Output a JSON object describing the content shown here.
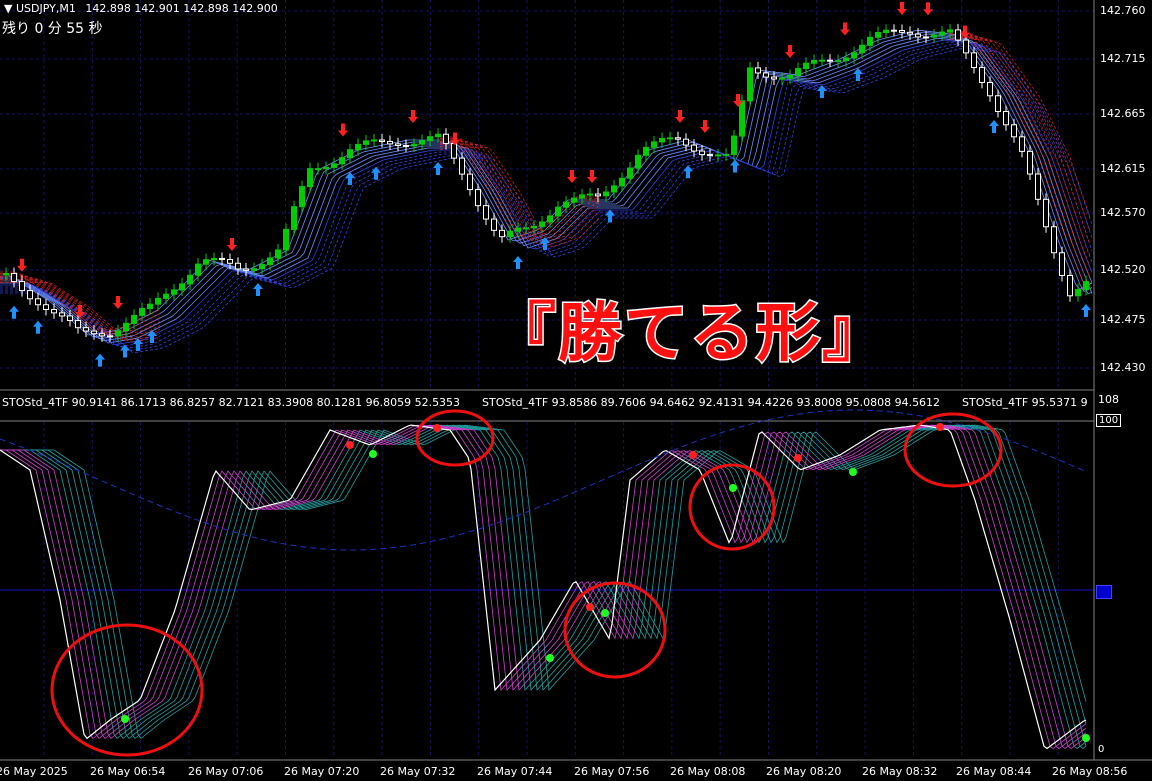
{
  "header": {
    "symbol": "USDJPY,M1",
    "ohlc": "142.898 142.901 142.898 142.900",
    "countdown": "残り 0 分 55 秒"
  },
  "headline": "『勝てる形』",
  "price_axis": {
    "labels": [
      "142.760",
      "142.715",
      "142.665",
      "142.615",
      "142.570",
      "142.520",
      "142.475",
      "142.430"
    ]
  },
  "indicator": {
    "label1": "STOStd_4TF 90.9141 86.1713 86.8257 82.7121 83.3908 80.1281 96.8059 52.5353",
    "label2": "STOStd_4TF 93.8586 89.7606 94.6462 92.4131 94.4226 93.8008 95.0808 94.5612",
    "label3": "STOStd_4TF 95.5371 9",
    "axis_top": "108",
    "axis_100": "100",
    "axis_bottom": "0"
  },
  "time_axis": {
    "labels": [
      "26 May 2025",
      "26 May 06:54",
      "26 May 07:06",
      "26 May 07:20",
      "26 May 07:32",
      "26 May 07:44",
      "26 May 07:56",
      "26 May 08:08",
      "26 May 08:20",
      "26 May 08:32",
      "26 May 08:44",
      "26 May 08:56"
    ]
  },
  "colors": {
    "bull": "#00cc00",
    "bear": "#ffffff",
    "up_arrow": "#1e90ff",
    "down_arrow": "#ff2020",
    "grid": "#1a1a6a",
    "headline": "#ff1010"
  }
}
